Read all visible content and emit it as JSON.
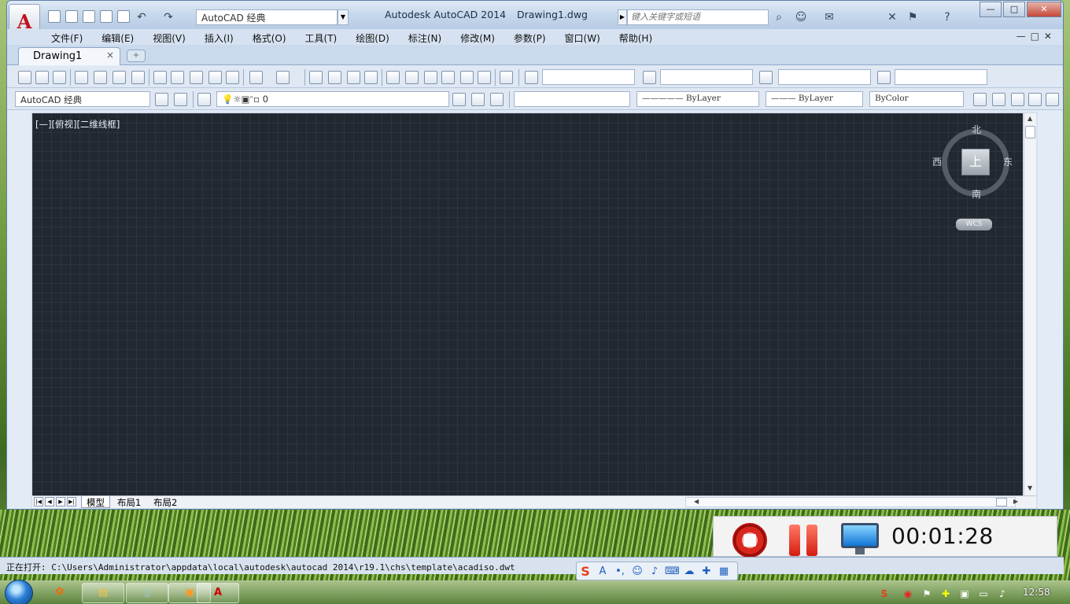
{
  "window": {
    "title": "Autodesk AutoCAD 2014",
    "file": "Drawing1.dwg",
    "workspace_quick": "AutoCAD 经典",
    "search_placeholder": "键入关键字或短语",
    "logo_letter": "A",
    "close_glyph": "✕",
    "min_glyph": "—",
    "max_glyph": "□"
  },
  "menu": [
    "文件(F)",
    "编辑(E)",
    "视图(V)",
    "插入(I)",
    "格式(O)",
    "工具(T)",
    "绘图(D)",
    "标注(N)",
    "修改(M)",
    "参数(P)",
    "窗口(W)",
    "帮助(H)"
  ],
  "mdi_controls": "—□✕",
  "tabs": {
    "document": "Drawing1",
    "close": "×",
    "new": "+"
  },
  "toolbar2": {
    "workspace": "AutoCAD 经典",
    "layer": "0",
    "linetype": "ByLayer",
    "lineweight": "ByLayer",
    "plotstyle": "ByColor"
  },
  "viewport": {
    "label": "[—][俯视][二维线框]"
  },
  "viewcube": {
    "north": "北",
    "south": "南",
    "east": "东",
    "west": "西",
    "top": "上",
    "wcs": "WCS"
  },
  "layouts": [
    "模型",
    "布局1",
    "布局2"
  ],
  "nav_glyphs": [
    "|◀",
    "◀",
    "▶",
    "▶|"
  ],
  "status": {
    "text": "正在打开: C:\\Users\\Administrator\\appdata\\local\\autodesk\\autocad 2014\\r19.1\\chs\\template\\acadiso.dwt"
  },
  "recorder": {
    "time": "00:01:28"
  },
  "taskbar": {
    "clock": "12:58"
  },
  "colors": {
    "canvas": "#212830",
    "accent_red": "#d8251d",
    "window_blue": "#c7d8ec"
  },
  "icons": {
    "ime": [
      "S",
      "A",
      "•,",
      "☺",
      "♪",
      "⌨",
      "☁",
      "✚",
      "▦"
    ],
    "tray": [
      "S",
      "◉",
      "⚑",
      "✚",
      "▣",
      "▭",
      "♪"
    ]
  }
}
